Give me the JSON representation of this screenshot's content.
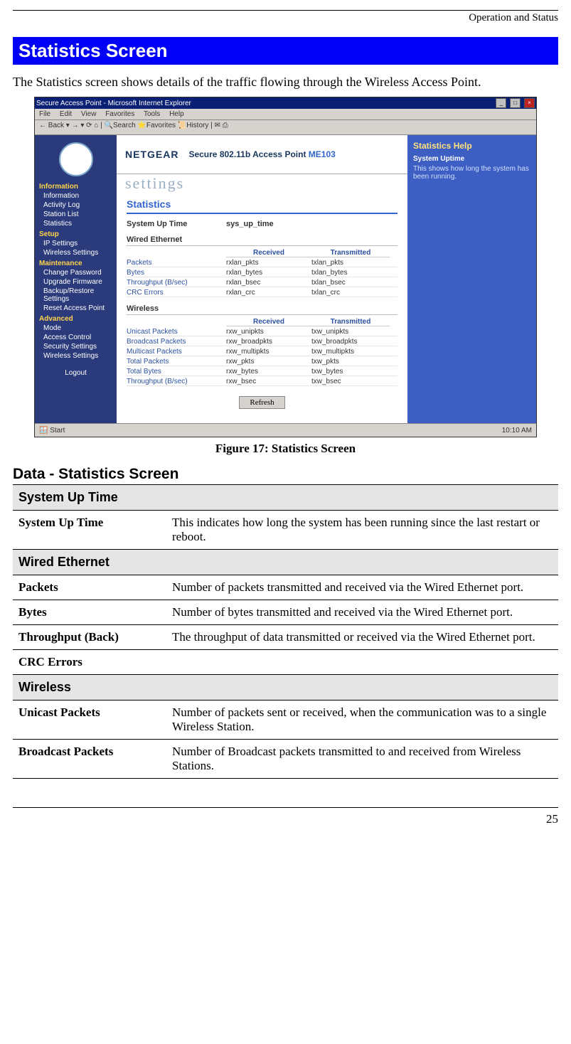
{
  "running_head": "Operation and Status",
  "h1": "Statistics Screen",
  "intro": "The Statistics screen shows details of the traffic flowing through the Wireless Access Point.",
  "figure_caption": "Figure 17: Statistics Screen",
  "h2": "Data - Statistics Screen",
  "page_number": "25",
  "screenshot": {
    "window_title": "Secure Access Point - Microsoft Internet Explorer",
    "menubar": [
      "File",
      "Edit",
      "View",
      "Favorites",
      "Tools",
      "Help"
    ],
    "banner_brand": "NETGEAR",
    "banner_sub": "Secure 802.11b Access Point",
    "banner_model": "ME103",
    "banner_settings": "settings",
    "nav": {
      "Information": [
        "Information",
        "Activity Log",
        "Station List",
        "Statistics"
      ],
      "Setup": [
        "IP Settings",
        "Wireless Settings"
      ],
      "Maintenance": [
        "Change Password",
        "Upgrade Firmware",
        "Backup/Restore Settings",
        "Reset Access Point"
      ],
      "Advanced": [
        "Mode",
        "Access Control",
        "Security Settings",
        "Wireless Settings"
      ]
    },
    "logout": "Logout",
    "content": {
      "title": "Statistics",
      "uptime_label": "System Up Time",
      "uptime_value": "sys_up_time",
      "wired_title": "Wired Ethernet",
      "cols": [
        "Received",
        "Transmitted"
      ],
      "wired_rows": [
        {
          "label": "Packets",
          "rx": "rxlan_pkts",
          "tx": "txlan_pkts"
        },
        {
          "label": "Bytes",
          "rx": "rxlan_bytes",
          "tx": "txlan_bytes"
        },
        {
          "label": "Throughput (B/sec)",
          "rx": "rxlan_bsec",
          "tx": "txlan_bsec"
        },
        {
          "label": "CRC Errors",
          "rx": "rxlan_crc",
          "tx": "txlan_crc"
        }
      ],
      "wireless_title": "Wireless",
      "wireless_rows": [
        {
          "label": "Unicast Packets",
          "rx": "rxw_unipkts",
          "tx": "txw_unipkts"
        },
        {
          "label": "Broadcast Packets",
          "rx": "rxw_broadpkts",
          "tx": "txw_broadpkts"
        },
        {
          "label": "Multicast Packets",
          "rx": "rxw_multipkts",
          "tx": "txw_multipkts"
        },
        {
          "label": "Total Packets",
          "rx": "rxw_pkts",
          "tx": "txw_pkts"
        },
        {
          "label": "Total Bytes",
          "rx": "rxw_bytes",
          "tx": "txw_bytes"
        },
        {
          "label": "Throughput (B/sec)",
          "rx": "rxw_bsec",
          "tx": "txw_bsec"
        }
      ],
      "refresh": "Refresh"
    },
    "help": {
      "title": "Statistics Help",
      "sub": "System Uptime",
      "text": "This shows how long the system has been running."
    },
    "taskbar_left": "Start",
    "taskbar_right": "10:10 AM"
  },
  "table": [
    {
      "type": "section",
      "label": "System Up Time"
    },
    {
      "type": "row",
      "key": "System Up Time",
      "val": "This indicates how long the system has been running since the last restart or reboot."
    },
    {
      "type": "section",
      "label": "Wired Ethernet"
    },
    {
      "type": "row",
      "key": "Packets",
      "val": "Number of packets transmitted and received via the Wired Ethernet port."
    },
    {
      "type": "row",
      "key": "Bytes",
      "val": "Number of bytes transmitted and received via the Wired Ethernet port."
    },
    {
      "type": "row",
      "key": "Throughput (Back)",
      "val": "The throughput of data transmitted or received via the Wired Ethernet port."
    },
    {
      "type": "row",
      "key": "CRC Errors",
      "val": ""
    },
    {
      "type": "section",
      "label": "Wireless"
    },
    {
      "type": "row",
      "key": "Unicast Packets",
      "val": "Number of packets sent or received, when the communication was to  a single Wireless Station."
    },
    {
      "type": "row",
      "key": "Broadcast Packets",
      "val": "Number of Broadcast packets transmitted to and received from Wireless Stations."
    }
  ]
}
